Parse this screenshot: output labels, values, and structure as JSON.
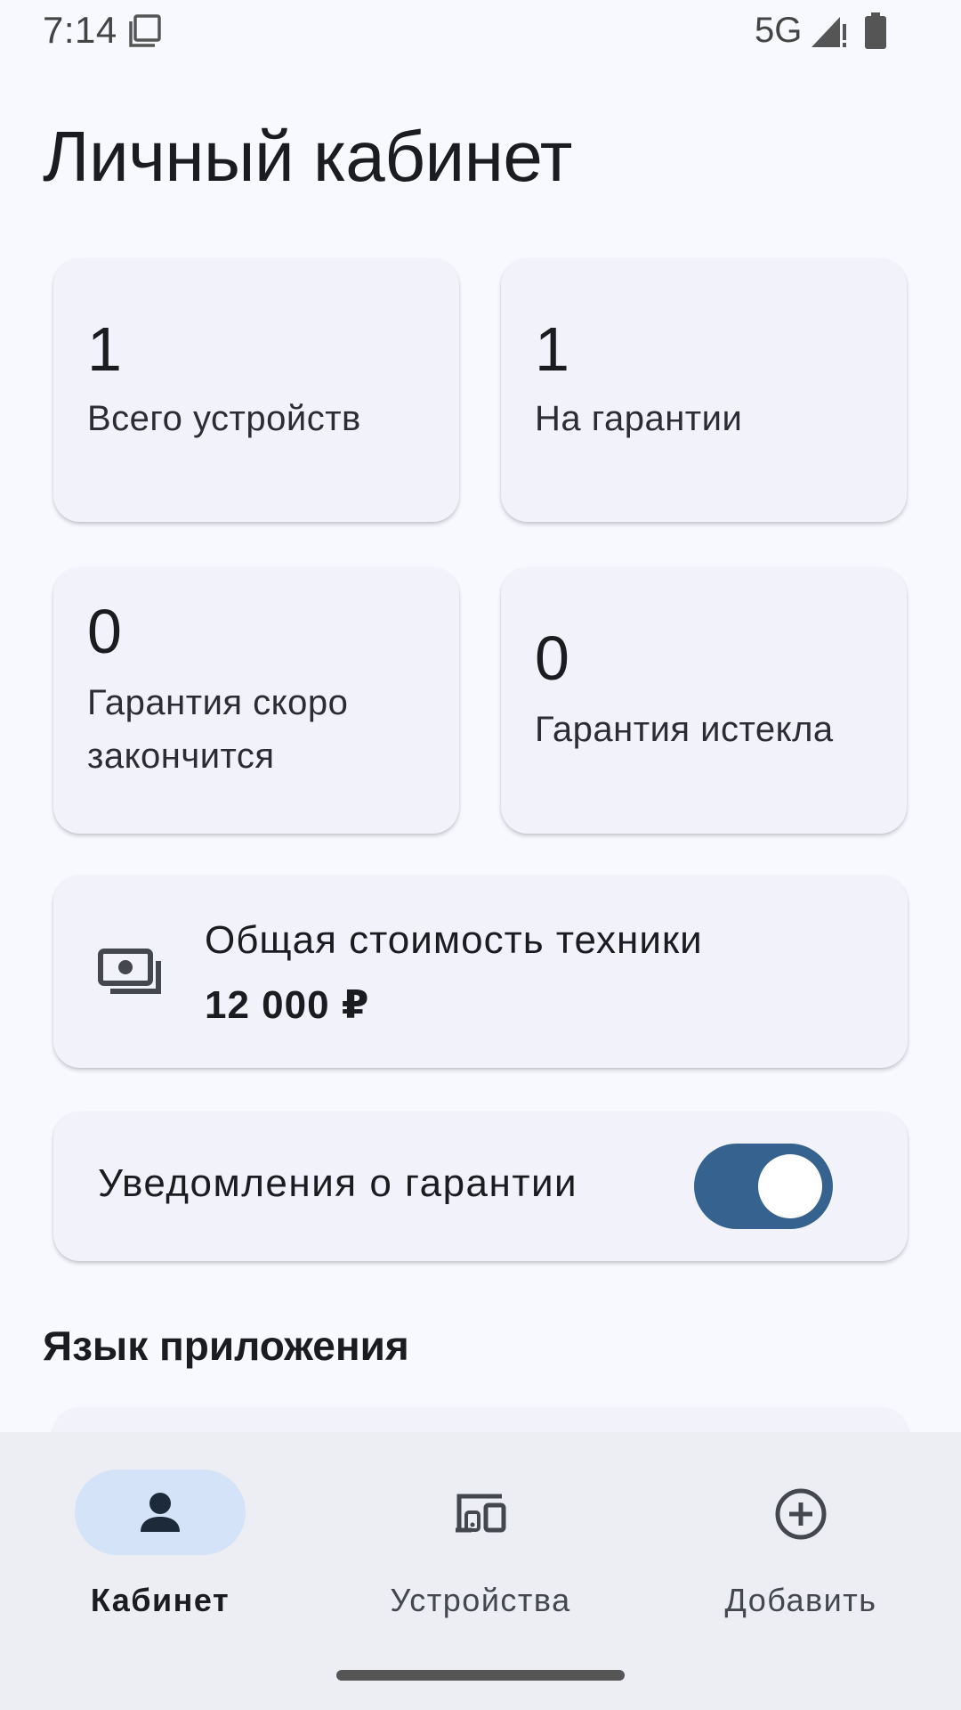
{
  "status_bar": {
    "time": "7:14",
    "network": "5G"
  },
  "header": {
    "title": "Личный кабинет"
  },
  "stats": {
    "total": {
      "value": "1",
      "label": "Всего устройств"
    },
    "warranty": {
      "value": "1",
      "label": "На гарантии"
    },
    "expiring": {
      "value": "0",
      "label_line1": "Гарантия скоро",
      "label_line2": "закончится"
    },
    "expired": {
      "value": "0",
      "label": "Гарантия истекла"
    }
  },
  "cost": {
    "label": "Общая стоимость техники",
    "value": "12 000 ₽",
    "icon": "payments-icon"
  },
  "notifications": {
    "label": "Уведомления о гарантии",
    "enabled": true
  },
  "language": {
    "title": "Язык приложения"
  },
  "bottom_nav": {
    "items": [
      {
        "label": "Кабинет",
        "icon": "person-icon",
        "active": true
      },
      {
        "label": "Устройства",
        "icon": "devices-icon",
        "active": false
      },
      {
        "label": "Добавить",
        "icon": "add-circle-icon",
        "active": false
      }
    ]
  },
  "colors": {
    "accent": "#35628f",
    "indicator": "#d4e3f7",
    "background": "#f8f9ff",
    "card": "#f2f3fa"
  }
}
